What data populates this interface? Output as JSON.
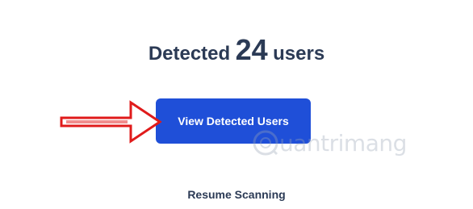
{
  "headline": {
    "prefix": "Detected",
    "count": "24",
    "suffix": "users"
  },
  "primary_button": {
    "label": "View Detected Users"
  },
  "secondary_link": {
    "label": "Resume Scanning"
  },
  "annotation": {
    "arrow_color": "#e01b1b"
  },
  "watermark": {
    "text": "uantrimang"
  },
  "colors": {
    "primary": "#1f4fd8",
    "text": "#2b3a55"
  }
}
